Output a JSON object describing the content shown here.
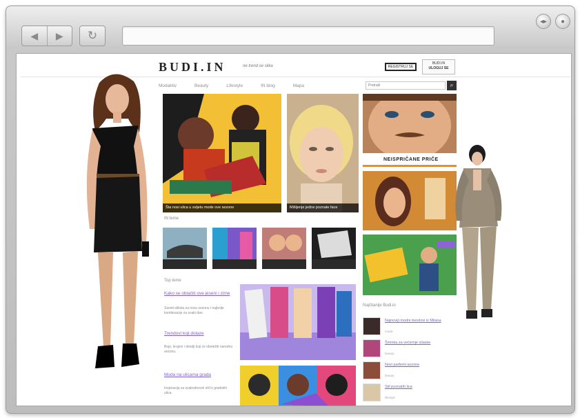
{
  "window": {
    "nav_back_icon": "arrow-left-icon",
    "nav_forward_icon": "arrow-right-icon",
    "reload_icon": "reload-icon",
    "address_value": "",
    "btn_a": "◂▸",
    "btn_b": "●"
  },
  "site": {
    "logo": "BUDI.IN",
    "tagline": "ne trend se slika",
    "register_label": "REGISTRUJ SE",
    "login_lines": [
      "BUDI.IN",
      "ULOGUJ SE"
    ],
    "nav": [
      "Modaktiv",
      "Beauty",
      "Lifestyle",
      "IN blog",
      "Mapa"
    ],
    "search_placeholder": "Pretraži",
    "search_btn": "⌕"
  },
  "content": {
    "hero_main_caption": "Šta nosi ulica u svijetu mode ove sezone",
    "hero_side_caption": "Mišljenje jedne poznate face",
    "section_in_tema": "IN teme",
    "section_top": "Top teme",
    "sidebar_banner": "NEISPRIČANE PRIČE",
    "section_sidebar": "Najčitanije Budi.in",
    "articles": [
      {
        "title": "Kako se oblačiti ove jeseni i zime",
        "text": "Saveti stilista za novu sezonu i najbolje kombinacije za svaki dan."
      },
      {
        "title": "Trendovi koji dolaze",
        "text": "Boje, krojevi i detalji koji će obeležiti narednu sezonu."
      },
      {
        "title": "Moda na ulicama grada",
        "text": "Inspiracija za svakodnevni stil iz gradskih ulica."
      }
    ],
    "sidebar_items": [
      {
        "title": "Najnoviji modni trendovi iz Milana",
        "meta": "moda"
      },
      {
        "title": "Šminka za večernje izlaske",
        "meta": "beauty"
      },
      {
        "title": "Novi parfemi sezone",
        "meta": "beauty"
      },
      {
        "title": "Stil poznatih lica",
        "meta": "lifestyle"
      }
    ]
  },
  "colors": {
    "accent_purple": "#7f5fd1",
    "accent_orange": "#f08c1a",
    "window_gray": "#c9c9c9"
  }
}
